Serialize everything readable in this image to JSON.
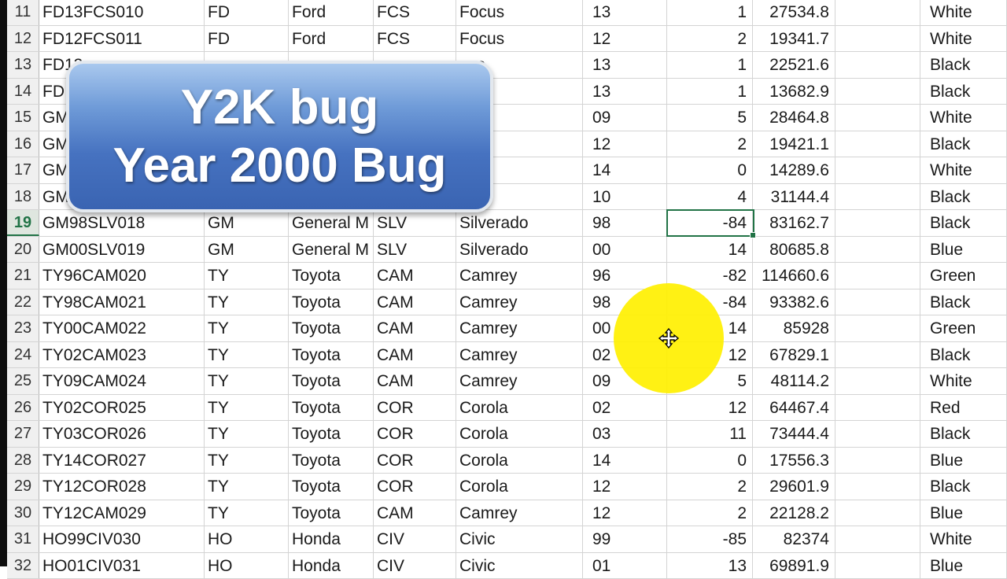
{
  "banner": {
    "line1": "Y2K bug",
    "line2": "Year 2000 Bug"
  },
  "colors": {
    "selection": "#217346",
    "highlight": "#fff000",
    "banner_top": "#a9c8ee",
    "banner_bottom": "#3a64b2"
  },
  "cursor_icon": "move-crosshair-icon",
  "active_row": "19",
  "selected_cell": {
    "row": "19",
    "value": "-84"
  },
  "rows": [
    {
      "num": "11",
      "cells": [
        "FD13FCS010",
        "FD",
        "Ford",
        "FCS",
        "Focus",
        "13",
        "1",
        "27534.8",
        "",
        "White"
      ]
    },
    {
      "num": "12",
      "cells": [
        "FD12FCS011",
        "FD",
        "Ford",
        "FCS",
        "Focus",
        "12",
        "2",
        "19341.7",
        "",
        "White"
      ]
    },
    {
      "num": "13",
      "cells": [
        "FD13",
        "",
        "",
        "",
        "cus",
        "13",
        "1",
        "22521.6",
        "",
        "Black"
      ]
    },
    {
      "num": "14",
      "cells": [
        "FD",
        "",
        "",
        "",
        "us",
        "13",
        "1",
        "13682.9",
        "",
        "Black"
      ]
    },
    {
      "num": "15",
      "cells": [
        "GM",
        "",
        "",
        "",
        "ero",
        "09",
        "5",
        "28464.8",
        "",
        "White"
      ]
    },
    {
      "num": "16",
      "cells": [
        "GM",
        "",
        "",
        "",
        "ero",
        "12",
        "2",
        "19421.1",
        "",
        "Black"
      ]
    },
    {
      "num": "17",
      "cells": [
        "GM",
        "",
        "",
        "",
        "ero",
        "14",
        "0",
        "14289.6",
        "",
        "White"
      ]
    },
    {
      "num": "18",
      "cells": [
        "GM",
        "",
        "",
        "",
        "rado",
        "10",
        "4",
        "31144.4",
        "",
        "Black"
      ]
    },
    {
      "num": "19",
      "cells": [
        "GM98SLV018",
        "GM",
        "General M",
        "SLV",
        "Silverado",
        "98",
        "-84",
        "83162.7",
        "",
        "Black"
      ]
    },
    {
      "num": "20",
      "cells": [
        "GM00SLV019",
        "GM",
        "General M",
        "SLV",
        "Silverado",
        "00",
        "14",
        "80685.8",
        "",
        "Blue"
      ]
    },
    {
      "num": "21",
      "cells": [
        "TY96CAM020",
        "TY",
        "Toyota",
        "CAM",
        "Camrey",
        "96",
        "-82",
        "114660.6",
        "",
        "Green"
      ]
    },
    {
      "num": "22",
      "cells": [
        "TY98CAM021",
        "TY",
        "Toyota",
        "CAM",
        "Camrey",
        "98",
        "-84",
        "93382.6",
        "",
        "Black"
      ]
    },
    {
      "num": "23",
      "cells": [
        "TY00CAM022",
        "TY",
        "Toyota",
        "CAM",
        "Camrey",
        "00",
        "14",
        "85928",
        "",
        "Green"
      ]
    },
    {
      "num": "24",
      "cells": [
        "TY02CAM023",
        "TY",
        "Toyota",
        "CAM",
        "Camrey",
        "02",
        "12",
        "67829.1",
        "",
        "Black"
      ]
    },
    {
      "num": "25",
      "cells": [
        "TY09CAM024",
        "TY",
        "Toyota",
        "CAM",
        "Camrey",
        "09",
        "5",
        "48114.2",
        "",
        "White"
      ]
    },
    {
      "num": "26",
      "cells": [
        "TY02COR025",
        "TY",
        "Toyota",
        "COR",
        "Corola",
        "02",
        "12",
        "64467.4",
        "",
        "Red"
      ]
    },
    {
      "num": "27",
      "cells": [
        "TY03COR026",
        "TY",
        "Toyota",
        "COR",
        "Corola",
        "03",
        "11",
        "73444.4",
        "",
        "Black"
      ]
    },
    {
      "num": "28",
      "cells": [
        "TY14COR027",
        "TY",
        "Toyota",
        "COR",
        "Corola",
        "14",
        "0",
        "17556.3",
        "",
        "Blue"
      ]
    },
    {
      "num": "29",
      "cells": [
        "TY12COR028",
        "TY",
        "Toyota",
        "COR",
        "Corola",
        "12",
        "2",
        "29601.9",
        "",
        "Black"
      ]
    },
    {
      "num": "30",
      "cells": [
        "TY12CAM029",
        "TY",
        "Toyota",
        "CAM",
        "Camrey",
        "12",
        "2",
        "22128.2",
        "",
        "Blue"
      ]
    },
    {
      "num": "31",
      "cells": [
        "HO99CIV030",
        "HO",
        "Honda",
        "CIV",
        "Civic",
        "99",
        "-85",
        "82374",
        "",
        "White"
      ]
    },
    {
      "num": "32",
      "cells": [
        "HO01CIV031",
        "HO",
        "Honda",
        "CIV",
        "Civic",
        "01",
        "13",
        "69891.9",
        "",
        "Blue"
      ]
    }
  ]
}
